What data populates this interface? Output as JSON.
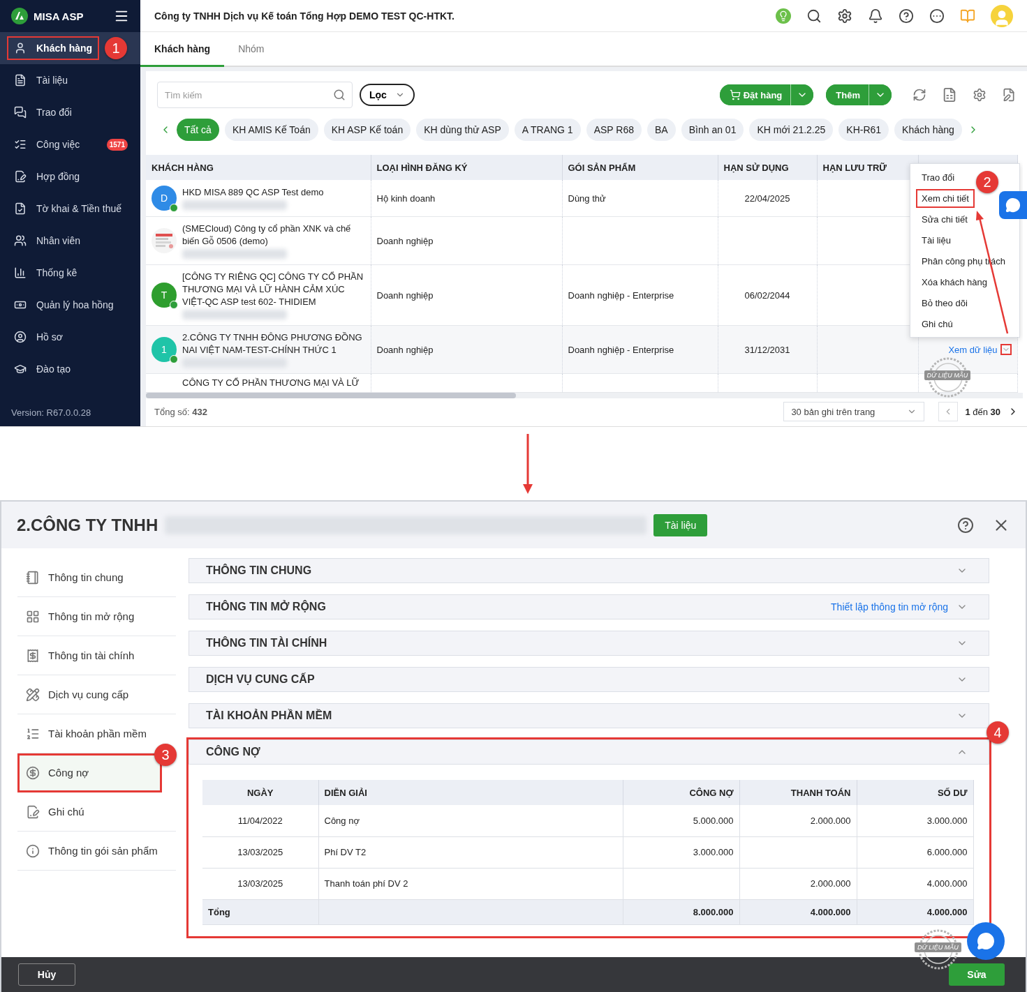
{
  "app": {
    "logo": "MISA ASP",
    "company": "Công ty TNHH Dịch vụ Kế toán Tổng Hợp DEMO TEST QC-HTKT.",
    "sidebar": {
      "items": [
        {
          "label": "Khách hàng",
          "selected": true,
          "highlighted": true,
          "callout": "1"
        },
        {
          "label": "Tài liệu",
          "selected": false
        },
        {
          "label": "Trao đổi",
          "selected": false
        },
        {
          "label": "Công việc",
          "selected": false,
          "badge": "1571"
        },
        {
          "label": "Hợp đồng",
          "selected": false
        },
        {
          "label": "Tờ khai & Tiền thuế",
          "selected": false
        },
        {
          "label": "Nhân viên",
          "selected": false
        },
        {
          "label": "Thống kê",
          "selected": false
        },
        {
          "label": "Quản lý hoa hồng",
          "selected": false
        },
        {
          "label": "Hồ sơ",
          "selected": false
        },
        {
          "label": "Đào tạo",
          "selected": false
        }
      ],
      "version": "Version: R67.0.0.28"
    },
    "tabs": [
      {
        "label": "Khách hàng",
        "selected": true
      },
      {
        "label": "Nhóm",
        "selected": false
      }
    ],
    "search": {
      "placeholder": "Tìm kiếm"
    },
    "filter": "Lọc",
    "order_button": "Đặt hàng",
    "add_button": "Thêm",
    "chips": [
      {
        "label": "Tất cả",
        "selected": true
      },
      {
        "label": "KH AMIS Kế Toán",
        "selected": false
      },
      {
        "label": "KH ASP Kế toán",
        "selected": false
      },
      {
        "label": "KH dùng thử ASP",
        "selected": false
      },
      {
        "label": "A TRANG 1",
        "selected": false
      },
      {
        "label": "ASP R68",
        "selected": false
      },
      {
        "label": "BA",
        "selected": false
      },
      {
        "label": "Bình an 01",
        "selected": false
      },
      {
        "label": "KH mới 21.2.25",
        "selected": false
      },
      {
        "label": "KH-R61",
        "selected": false
      },
      {
        "label": "Khách hàng",
        "selected": false
      }
    ],
    "table": {
      "columns": [
        "KHÁCH HÀNG",
        "LOẠI HÌNH ĐĂNG KÝ",
        "GÓI SẢN PHẨM",
        "HẠN SỬ DỤNG",
        "HẠN LƯU TRỮ"
      ],
      "rows": [
        {
          "avatar": {
            "kind": "letter",
            "text": "D",
            "color": "#2f8be6"
          },
          "name": "HKD MISA 889 QC ASP Test demo",
          "type": "Hộ kinh doanh",
          "package": "Dùng thử",
          "expiry": "22/04/2025"
        },
        {
          "name": "(SMECloud) Công ty cổ phần XNK và chế biến Gỗ 0506 (demo)",
          "type": "Doanh nghiệp"
        },
        {
          "avatar": {
            "kind": "letter",
            "text": "T",
            "color": "#2e9e2e"
          },
          "name": "[CÔNG TY RIÊNG QC] CÔNG TY CỔ PHẦN THƯƠNG MẠI VÀ LỮ HÀNH CẢM XÚC VIỆT-QC ASP test 602- THIDIEM",
          "type": "Doanh nghiệp",
          "package": "Doanh nghiệp - Enterprise",
          "expiry": "06/02/2044"
        },
        {
          "avatar": {
            "kind": "letter",
            "text": "1",
            "color": "#1fc4a8"
          },
          "name": "2.CÔNG TY TNHH ĐÔNG PHƯƠNG ĐỒNG NAI VIỆT NAM-TEST-CHÍNH THỨC 1",
          "type": "Doanh nghiệp",
          "package": "Doanh nghiệp - Enterprise",
          "expiry": "31/12/2031",
          "action": "Xem dữ liệu",
          "caret_highlighted": true,
          "stamp": "DỮ LIỆU MẪU"
        },
        {
          "name": "CÔNG TY CỔ PHẦN THƯƠNG MẠI VÀ LỮ"
        }
      ]
    },
    "row_menu": {
      "items": [
        {
          "label": "Trao đổi"
        },
        {
          "label": "Xem chi tiết",
          "highlighted": true,
          "callout": "2"
        },
        {
          "label": "Sửa chi tiết"
        },
        {
          "label": "Tài liệu"
        },
        {
          "label": "Phân công phụ trách"
        },
        {
          "label": "Xóa khách hàng"
        },
        {
          "label": "Bỏ theo dõi"
        },
        {
          "label": "Ghi chú"
        }
      ]
    },
    "total_label": "Tổng số:",
    "total": "432",
    "page_size": "30 bản ghi trên trang",
    "range": "**1** đến **30**"
  },
  "dialog": {
    "title": "2.CÔNG TY TNHH",
    "docs_button": "Tài liệu",
    "nav": [
      {
        "label": "Thông tin chung",
        "selected": false
      },
      {
        "label": "Thông tin mở rộng",
        "selected": false
      },
      {
        "label": "Thông tin tài chính",
        "selected": false
      },
      {
        "label": "Dịch vụ cung cấp",
        "selected": false
      },
      {
        "label": "Tài khoản phần mềm",
        "selected": false
      },
      {
        "label": "Công nợ",
        "selected": true,
        "highlighted": true,
        "callout": "3"
      },
      {
        "label": "Ghi chú",
        "selected": false
      },
      {
        "label": "Thông tin gói sản phẩm",
        "selected": false
      }
    ],
    "sections": [
      {
        "title": "THÔNG TIN CHUNG",
        "expanded": false
      },
      {
        "title": "THÔNG TIN MỞ RỘNG",
        "expanded": false,
        "link": "Thiết lập thông tin mở rộng"
      },
      {
        "title": "THÔNG TIN TÀI CHÍNH",
        "expanded": false
      },
      {
        "title": "DỊCH VỤ CUNG CẤP",
        "expanded": false
      },
      {
        "title": "TÀI KHOẢN PHẦN MỀM",
        "expanded": false
      },
      {
        "title": "CÔNG NỢ",
        "expanded": true,
        "highlighted": true,
        "callout": "4"
      }
    ],
    "debt_table": {
      "columns": [
        "NGÀY",
        "DIỄN GIẢI",
        "CÔNG NỢ",
        "THANH TOÁN",
        "SỐ DƯ"
      ],
      "rows": [
        {
          "date": "11/04/2022",
          "description": "Công nợ",
          "debt": "5.000.000",
          "paid": "2.000.000",
          "balance": "3.000.000"
        },
        {
          "date": "13/03/2025",
          "description": "Phí DV T2",
          "debt": "3.000.000",
          "balance": "6.000.000"
        },
        {
          "date": "13/03/2025",
          "description": "Thanh toán phí DV 2",
          "paid": "2.000.000",
          "balance": "4.000.000"
        }
      ],
      "total": {
        "label": "Tổng",
        "debt": "8.000.000",
        "paid": "4.000.000",
        "balance": "4.000.000"
      }
    },
    "stamp": "DỮ LIỆU MẪU",
    "cancel_button": "Hủy",
    "edit_button": "Sửa"
  }
}
